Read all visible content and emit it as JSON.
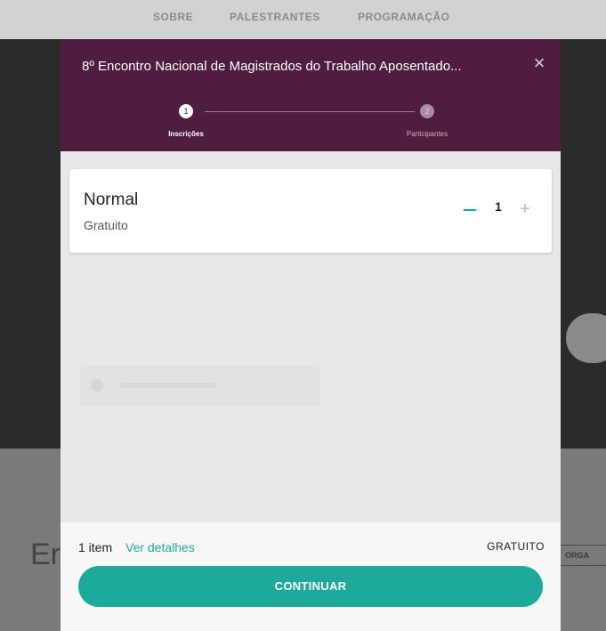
{
  "background": {
    "nav_items": [
      "SOBRE",
      "PALESTRANTES",
      "PROGRAMAÇÃO"
    ],
    "partial_heading": "Er",
    "partial_button": "ORGA"
  },
  "modal": {
    "title": "8º Encontro Nacional de Magistrados do Trabalho Aposentado...",
    "close_icon": "close-icon",
    "steps": [
      {
        "number": "1",
        "label": "Inscrições",
        "active": true
      },
      {
        "number": "2",
        "label": "Participantes",
        "active": false
      }
    ],
    "ticket": {
      "name": "Normal",
      "price": "Gratuito",
      "quantity": "1",
      "minus_icon": "minus-icon",
      "plus_icon": "plus-icon"
    },
    "footer": {
      "count": "1 item",
      "details_link": "Ver detalhes",
      "total": "GRATUITO",
      "continue_label": "CONTINUAR"
    }
  },
  "colors": {
    "header": "#4f1e3e",
    "accent": "#1eaa9b",
    "modal_body": "#e8e8e8"
  }
}
